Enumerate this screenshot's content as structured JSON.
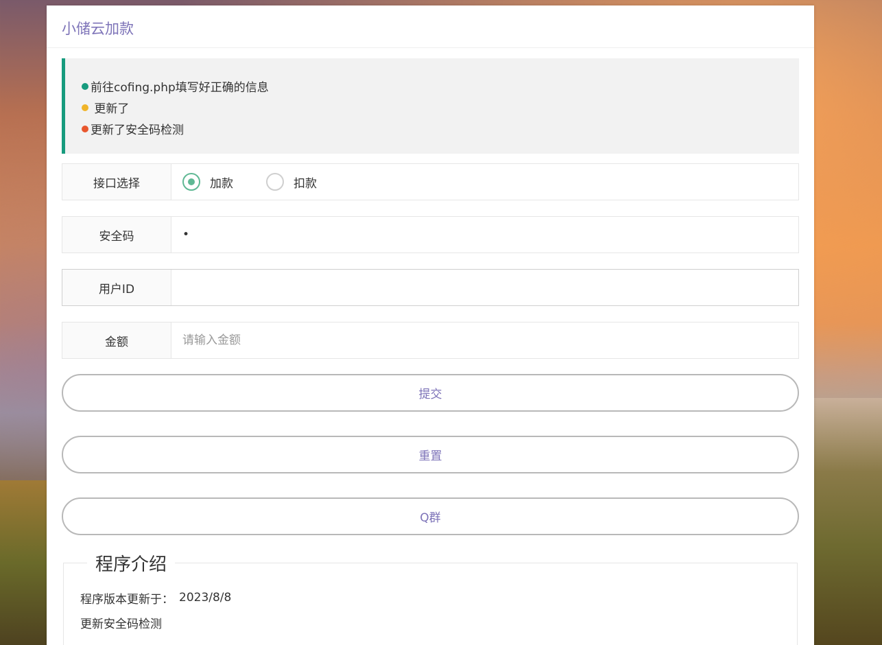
{
  "header": {
    "title": "小储云加款"
  },
  "notice": {
    "items": [
      {
        "text": "前往cofing.php填写好正确的信息",
        "color": "#179b7e"
      },
      {
        "text": " 更新了",
        "color": "#f0b429"
      },
      {
        "text": "更新了安全码检测",
        "color": "#e8572e"
      }
    ]
  },
  "form": {
    "interface": {
      "label": "接口选择",
      "options": [
        "加款",
        "扣款"
      ],
      "selected": "加款"
    },
    "security_code": {
      "label": "安全码",
      "value": "•"
    },
    "user_id": {
      "label": "用户ID",
      "value": ""
    },
    "amount": {
      "label": "金额",
      "placeholder": "请输入金额"
    }
  },
  "buttons": {
    "submit": "提交",
    "reset": "重置",
    "qq_group": "Q群"
  },
  "intro": {
    "legend": "程序介绍",
    "version_label": "程序版本更新于：",
    "version_date": "2023/8/8",
    "update_note": "更新安全码检测"
  },
  "colors": {
    "accent": "#7d73b8",
    "notice_border": "#179b7e",
    "radio_checked": "#5fb894"
  }
}
